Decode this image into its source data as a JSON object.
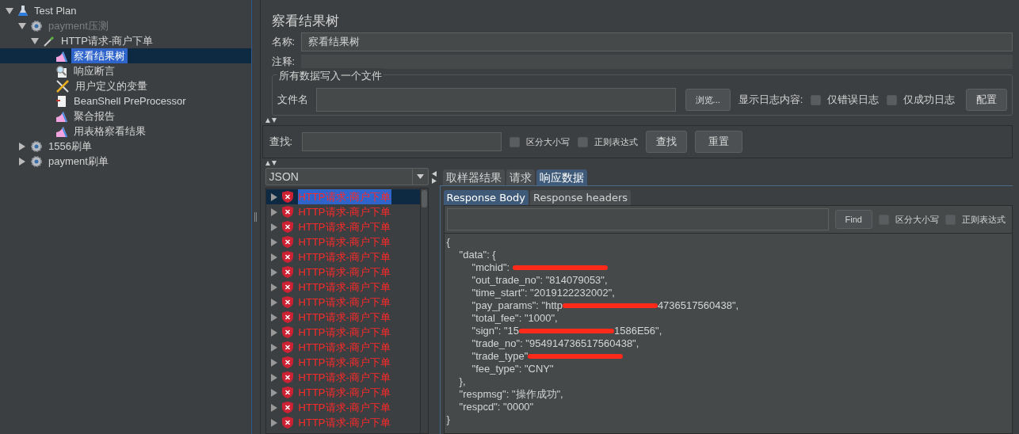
{
  "tree": [
    {
      "label": "Test Plan",
      "kind": "plan",
      "expanded": true,
      "selected": false,
      "disabled": false,
      "children": [
        {
          "label": "payment压测",
          "kind": "group",
          "expanded": true,
          "selected": false,
          "disabled": true,
          "children": [
            {
              "label": "HTTP请求-商户下单",
              "kind": "sampler",
              "expanded": true,
              "selected": false,
              "disabled": false,
              "children": [
                {
                  "label": "察看结果树",
                  "kind": "listener",
                  "selected": true,
                  "disabled": false
                },
                {
                  "label": "响应断言",
                  "kind": "assertion",
                  "selected": false,
                  "disabled": false
                },
                {
                  "label": "用户定义的变量",
                  "kind": "config",
                  "selected": false,
                  "disabled": false
                },
                {
                  "label": "BeanShell PreProcessor",
                  "kind": "preprocessor",
                  "selected": false,
                  "disabled": false
                },
                {
                  "label": "聚合报告",
                  "kind": "listener",
                  "selected": false,
                  "disabled": false
                },
                {
                  "label": "用表格察看结果",
                  "kind": "listener",
                  "selected": false,
                  "disabled": false
                }
              ]
            }
          ]
        },
        {
          "label": "1556刷单",
          "kind": "group",
          "expanded": false,
          "selected": false,
          "disabled": false
        },
        {
          "label": "payment刷单",
          "kind": "group",
          "expanded": false,
          "selected": false,
          "disabled": false
        }
      ]
    }
  ],
  "panel": {
    "title": "察看结果树",
    "name_label": "名称:",
    "name_value": "察看结果树",
    "comment_label": "注释:",
    "file_group": {
      "legend": "所有数据写入一个文件",
      "file_label": "文件名",
      "browse": "浏览...",
      "log_label": "显示日志内容:",
      "options": [
        {
          "label": "仅错误日志",
          "checked": false
        },
        {
          "label": "仅成功日志",
          "checked": false
        }
      ],
      "config": "配置"
    },
    "search": {
      "label": "查找:",
      "options": [
        {
          "label": "区分大小写",
          "checked": false
        },
        {
          "label": "正则表达式",
          "checked": false
        }
      ],
      "find": "查找",
      "reset": "重置"
    },
    "renderer": "JSON",
    "results": [
      {
        "label": "HTTP请求-商户下单",
        "selected": true
      },
      {
        "label": "HTTP请求-商户下单",
        "selected": false
      },
      {
        "label": "HTTP请求-商户下单",
        "selected": false
      },
      {
        "label": "HTTP请求-商户下单",
        "selected": false
      },
      {
        "label": "HTTP请求-商户下单",
        "selected": false
      },
      {
        "label": "HTTP请求-商户下单",
        "selected": false
      },
      {
        "label": "HTTP请求-商户下单",
        "selected": false
      },
      {
        "label": "HTTP请求-商户下单",
        "selected": false
      },
      {
        "label": "HTTP请求-商户下单",
        "selected": false
      },
      {
        "label": "HTTP请求-商户下单",
        "selected": false
      },
      {
        "label": "HTTP请求-商户下单",
        "selected": false
      },
      {
        "label": "HTTP请求-商户下单",
        "selected": false
      },
      {
        "label": "HTTP请求-商户下单",
        "selected": false
      },
      {
        "label": "HTTP请求-商户下单",
        "selected": false
      },
      {
        "label": "HTTP请求-商户下单",
        "selected": false
      },
      {
        "label": "HTTP请求-商户下单",
        "selected": false
      }
    ],
    "tabs": [
      {
        "label": "取样器结果",
        "selected": false
      },
      {
        "label": "请求",
        "selected": false
      },
      {
        "label": "响应数据",
        "selected": true
      }
    ],
    "subtabs": [
      {
        "label": "Response Body",
        "selected": true
      },
      {
        "label": "Response headers",
        "selected": false
      }
    ],
    "body_search": {
      "find": "Find",
      "options": [
        {
          "label": "区分大小写",
          "checked": false
        },
        {
          "label": "正则表达式",
          "checked": false
        }
      ]
    },
    "body_lines": [
      {
        "text": "{",
        "children": [
          {
            "text": "\"data\": {",
            "children": [
              {
                "kind": "redacted",
                "text": "\"mchid\": "
              },
              {
                "text": "\"out_trade_no\": \"814079053\","
              },
              {
                "text": "\"time_start\": \"2019122232002\","
              },
              {
                "kind": "redacted",
                "text": "\"pay_params\": \"http",
                "after": "4736517560438\","
              },
              {
                "text": "\"total_fee\": \"1000\","
              },
              {
                "kind": "redacted",
                "text": "\"sign\": \"15",
                "after": "1586E56\","
              },
              {
                "text": "\"trade_no\": \"954914736517560438\","
              },
              {
                "kind": "redacted",
                "text": "\"trade_type\""
              },
              {
                "text": "\"fee_type\": \"CNY\""
              }
            ]
          },
          {
            "text": "},"
          },
          {
            "text": "\"respmsg\": \"操作成功\","
          },
          {
            "text": "\"respcd\": \"0000\""
          }
        ]
      },
      {
        "text": "}"
      }
    ]
  }
}
